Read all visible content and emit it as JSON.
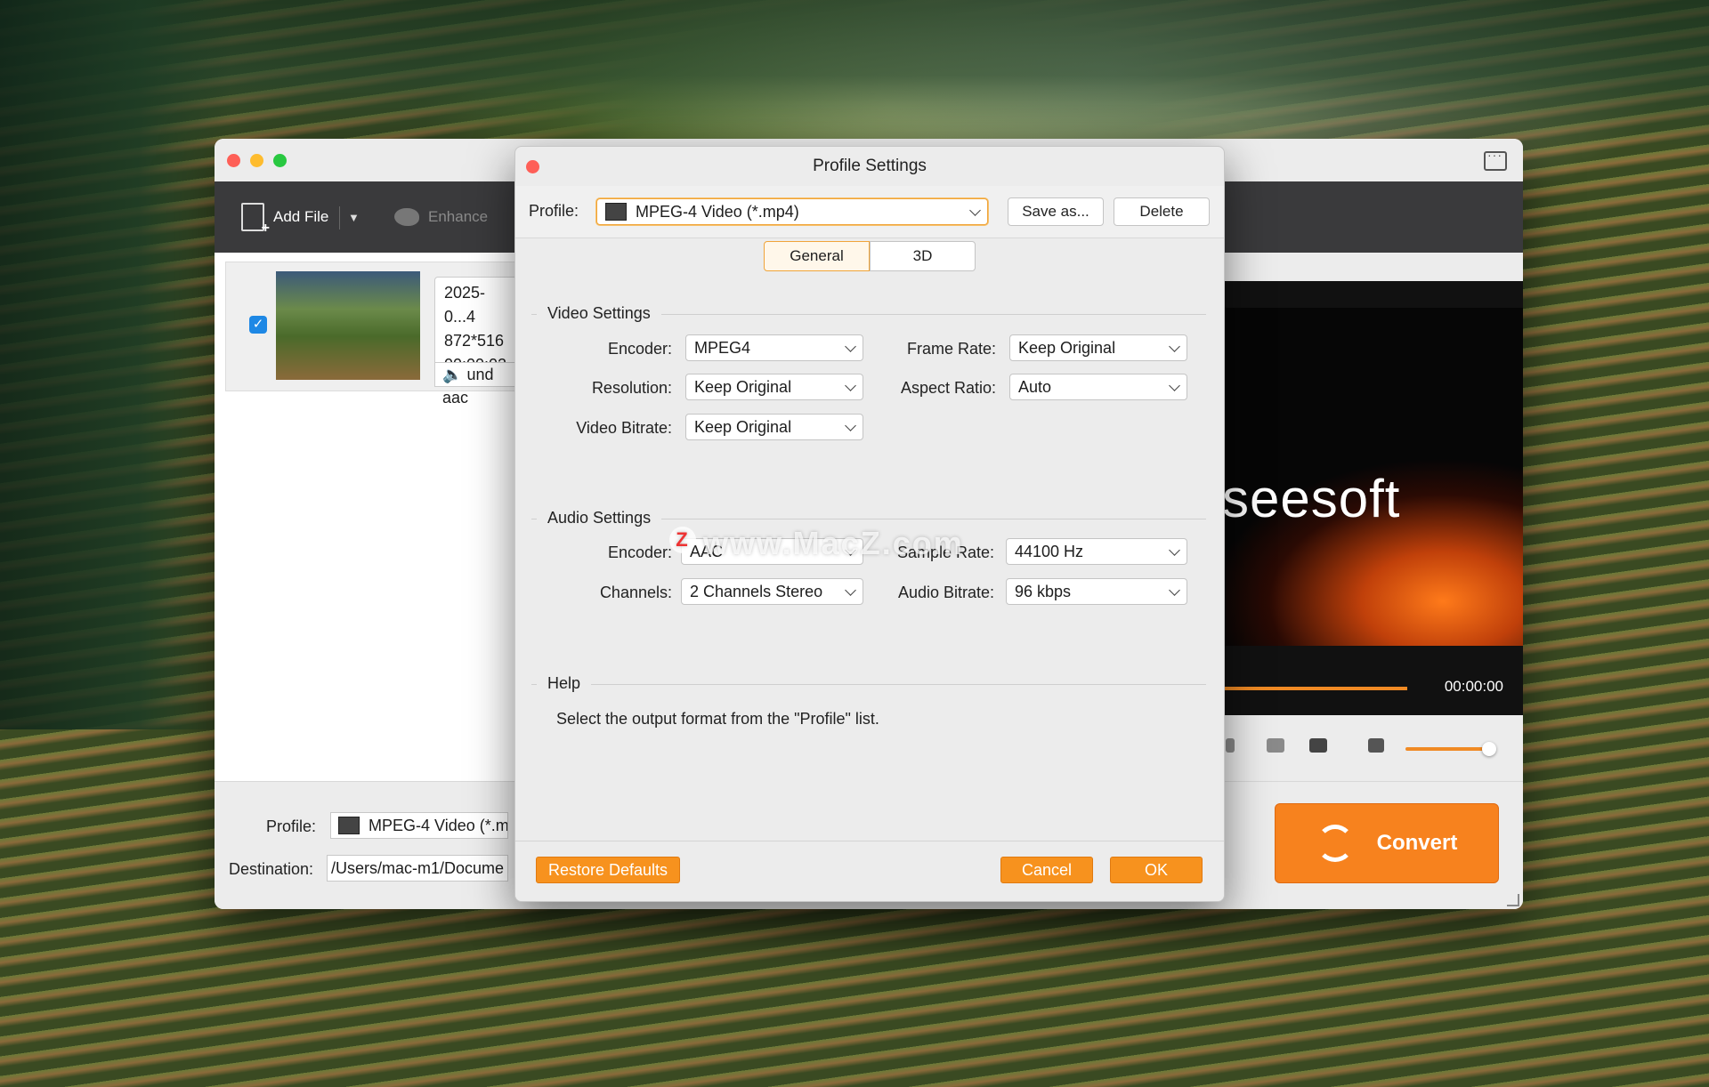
{
  "app": {
    "toolbar": {
      "add_file": "Add File",
      "enhance": "Enhance"
    },
    "file": {
      "name": "2025-0...4",
      "resolution": "872*516",
      "duration": "00:00:02",
      "audio": "und aac"
    },
    "preview": {
      "brand": "seesoft",
      "time": "00:00:00"
    },
    "bottom": {
      "profile_label": "Profile:",
      "profile_value": "MPEG-4 Video (*.m",
      "destination_label": "Destination:",
      "destination_value": "/Users/mac-m1/Docume",
      "convert": "Convert"
    }
  },
  "dialog": {
    "title": "Profile Settings",
    "profile_label": "Profile:",
    "profile_value": "MPEG-4 Video (*.mp4)",
    "save_as": "Save as...",
    "delete": "Delete",
    "tabs": [
      "General",
      "3D"
    ],
    "video": {
      "title": "Video Settings",
      "encoder_label": "Encoder:",
      "encoder": "MPEG4",
      "frame_rate_label": "Frame Rate:",
      "frame_rate": "Keep Original",
      "resolution_label": "Resolution:",
      "resolution": "Keep Original",
      "aspect_label": "Aspect Ratio:",
      "aspect": "Auto",
      "bitrate_label": "Video Bitrate:",
      "bitrate": "Keep Original"
    },
    "audio": {
      "title": "Audio Settings",
      "encoder_label": "Encoder:",
      "encoder": "AAC",
      "sample_label": "Sample Rate:",
      "sample": "44100 Hz",
      "channels_label": "Channels:",
      "channels": "2 Channels Stereo",
      "bitrate_label": "Audio Bitrate:",
      "bitrate": "96 kbps"
    },
    "help": {
      "title": "Help",
      "text": "Select the output format from the \"Profile\" list."
    },
    "restore": "Restore Defaults",
    "cancel": "Cancel",
    "ok": "OK"
  },
  "watermark": "www.MacZ.com",
  "colors": {
    "accent": "#f7921e",
    "checkbox": "#1e88e5"
  }
}
